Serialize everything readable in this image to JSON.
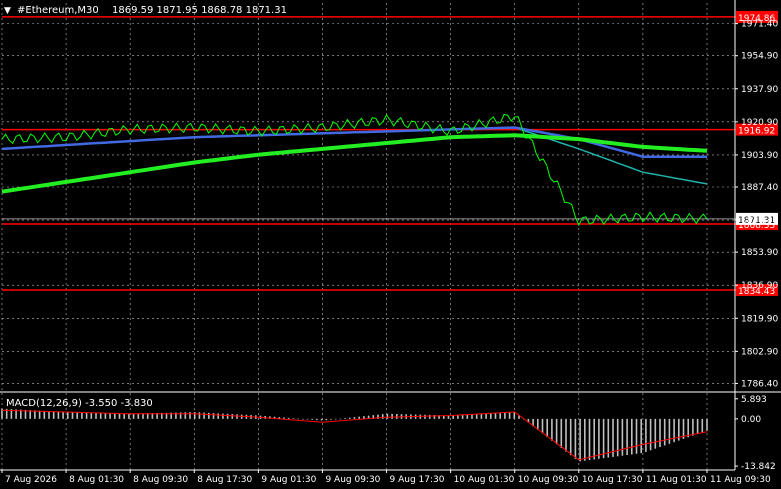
{
  "header": {
    "symbol": "#Ethereum,M30",
    "ohlc": "1869.59 1871.95 1868.78 1871.31",
    "arrow_glyph": "▼"
  },
  "macd_label": "MACD(12,26,9) -3.550 -3.830",
  "price_axis": {
    "ticks": [
      "1971.40",
      "1954.90",
      "1937.90",
      "1920.90",
      "1903.90",
      "1887.40",
      "1870.40",
      "1853.90",
      "1836.90",
      "1819.90",
      "1802.90",
      "1786.40"
    ],
    "tick_values": [
      1971.4,
      1954.9,
      1937.9,
      1920.9,
      1903.9,
      1887.4,
      1870.4,
      1853.9,
      1836.9,
      1819.9,
      1802.9,
      1786.4
    ]
  },
  "macd_axis": {
    "ticks": [
      "5.893",
      "0.00",
      "-13.842"
    ],
    "tick_values": [
      5.893,
      0.0,
      -13.842
    ]
  },
  "time_axis": {
    "labels": [
      "7 Aug 2026",
      "8 Aug 01:30",
      "8 Aug 09:30",
      "8 Aug 17:30",
      "9 Aug 01:30",
      "9 Aug 09:30",
      "9 Aug 17:30",
      "10 Aug 01:30",
      "10 Aug 09:30",
      "10 Aug 17:30",
      "11 Aug 01:30",
      "11 Aug 09:30"
    ]
  },
  "levels": [
    {
      "value": 1974.86,
      "label": "1974.86"
    },
    {
      "value": 1916.92,
      "label": "1916.92"
    },
    {
      "value": 1868.35,
      "label": "1868.35"
    },
    {
      "value": 1834.43,
      "label": "1834.43"
    }
  ],
  "current_price_label": "1871.31",
  "colors": {
    "background": "#000000",
    "grid": "#c0c0c0",
    "price": "#00ff00",
    "level": "#ff0000",
    "ma_slow": "#22ee22",
    "ma_mid": "#4169e1",
    "ma_fast": "#20b2aa",
    "macd_hist": "#c0c0c0",
    "macd_signal": "#ff0000",
    "axis_text": "#ffffff"
  },
  "chart_data": {
    "type": "line",
    "title": "#Ethereum,M30",
    "xlabel": "",
    "ylabel": "",
    "ylim": [
      1782,
      1982
    ],
    "x": [
      "7 Aug 2026",
      "8 Aug 01:30",
      "8 Aug 09:30",
      "8 Aug 17:30",
      "9 Aug 01:30",
      "9 Aug 09:30",
      "9 Aug 17:30",
      "10 Aug 01:30",
      "10 Aug 09:30",
      "10 Aug 17:30",
      "11 Aug 01:30",
      "11 Aug 09:30"
    ],
    "series": [
      {
        "values": [
          1912,
          1913,
          1917,
          1918,
          1916,
          1918,
          1922,
          1916,
          1924,
          1870,
          1872,
          1871
        ]
      },
      {
        "values": [
          1885,
          1890,
          1895,
          1900,
          1904,
          1907,
          1910,
          1913,
          1914,
          1912,
          1908,
          1906
        ]
      },
      {
        "values": [
          1907,
          1909,
          1911,
          1913,
          1914,
          1915,
          1916,
          1917,
          1918,
          1912,
          1903,
          1903
        ]
      },
      {
        "values": [
          1907,
          1909,
          1911,
          1913,
          1914,
          1915,
          1916,
          1917,
          1918,
          1907,
          1895,
          1889
        ]
      }
    ],
    "macd": {
      "ylim": [
        -15,
        7
      ],
      "hist": [
        3,
        2,
        1.5,
        2,
        1,
        -0.5,
        1.5,
        1,
        2,
        -12.5,
        -10,
        -3.5
      ],
      "signal": [
        2.5,
        2,
        1.5,
        1.5,
        0.5,
        -1,
        0.5,
        1,
        2,
        -12,
        -7.5,
        -3.8
      ]
    }
  }
}
